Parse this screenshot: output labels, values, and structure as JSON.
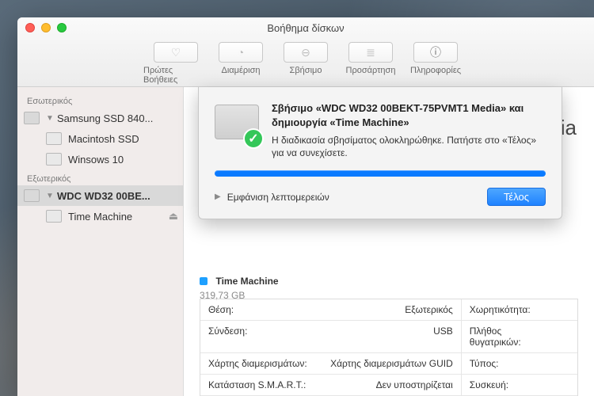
{
  "window": {
    "title": "Βοήθημα δίσκων"
  },
  "toolbar": {
    "first_aid": "Πρώτες Βοήθειες",
    "partition": "Διαμέριση",
    "erase": "Σβήσιμο",
    "mount": "Προσάρτηση",
    "info": "Πληροφορίες"
  },
  "sidebar": {
    "internal_header": "Εσωτερικός",
    "external_header": "Εξωτερικός",
    "internal_drive": "Samsung SSD 840...",
    "internal_vols": [
      "Macintosh SSD",
      "Winsows 10"
    ],
    "external_drive": "WDC WD32 00BE...",
    "external_vols": [
      "Time Machine"
    ]
  },
  "content": {
    "drive_title_fragment": "Media",
    "capacity": {
      "name": "Time Machine",
      "size": "319,73 GB"
    },
    "info": {
      "labels": {
        "location": "Θέση:",
        "connection": "Σύνδεση:",
        "partition_map": "Χάρτης διαμερισμάτων:",
        "smart": "Κατάσταση S.M.A.R.T.:",
        "capacity": "Χωρητικότητα:",
        "child_count": "Πλήθος θυγατρικών:",
        "type": "Τύπος:",
        "device": "Συσκευή:"
      },
      "values": {
        "location": "Εξωτερικός",
        "connection": "USB",
        "partition_map": "Χάρτης διαμερισμάτων GUID",
        "smart": "Δεν υποστηρίζεται"
      }
    }
  },
  "sheet": {
    "title": "Σβήσιμο «WDC WD32 00BEKT-75PVMT1 Media» και δημιουργία «Time Machine»",
    "message": "Η διαδικασία σβησίματος ολοκληρώθηκε. Πατήστε στο «Τέλος» για να συνεχίσετε.",
    "disclose": "Εμφάνιση λεπτομερειών",
    "done": "Τέλος"
  }
}
